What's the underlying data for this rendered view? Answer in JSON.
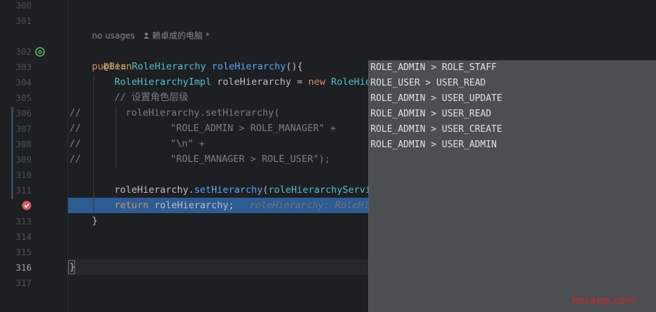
{
  "editor": {
    "line_numbers": [
      "300",
      "301",
      "302",
      "303",
      "304",
      "305",
      "306",
      "307",
      "308",
      "309",
      "310",
      "311",
      "",
      "313",
      "314",
      "315",
      "316",
      "317"
    ],
    "usage_hint": "no usages",
    "author_hint": "赖卓成的电脑 *",
    "annotation": "@Bean",
    "line303": {
      "kw": "public",
      "type": "RoleHierarchy",
      "name": "roleHierarchy",
      "rest": "(){"
    },
    "line304": {
      "type": "RoleHierarchyImpl",
      "var": " roleHierarchy = ",
      "kw": "new",
      "type2": " RoleHie"
    },
    "line305": "// 设置角色层级",
    "line306": {
      "prefix": "//",
      "code": "roleHierarchy.setHierarchy("
    },
    "line307": {
      "prefix": "//",
      "str": "\"ROLE_ADMIN > ROLE_MANAGER\"",
      "rest": " +"
    },
    "line308": {
      "prefix": "//",
      "str": "\"\\n\"",
      "rest": " +"
    },
    "line309": {
      "prefix": "//",
      "str": "\"ROLE_MANAGER > ROLE_USER\"",
      "rest": ");"
    },
    "line311": {
      "obj": "roleHierarchy.",
      "fn": "setHierarchy",
      "paren": "(",
      "arg": "roleHierarchyServic"
    },
    "line312": {
      "kw": "return",
      "rest": " roleHierarchy;",
      "hint": "roleHierarchy: RoleHie"
    },
    "line313": "}",
    "line316": "}"
  },
  "popup": {
    "items": [
      "ROLE_ADMIN > ROLE_STAFF",
      "ROLE_USER > USER_READ",
      "ROLE_ADMIN > USER_UPDATE",
      "ROLE_ADMIN > USER_READ",
      "ROLE_ADMIN > USER_CREATE",
      "ROLE_ADMIN > USER_ADMIN"
    ]
  },
  "watermark": "kocanp.com",
  "icons": {
    "bean_gutter": "spring-bean-icon",
    "breakpoint": "breakpoint-icon",
    "user": "user-icon"
  },
  "colors": {
    "selection": "#2d5b94",
    "popup_bg": "#4c4f52",
    "keyword": "#cf8e6d",
    "annotation": "#b3ae60"
  }
}
